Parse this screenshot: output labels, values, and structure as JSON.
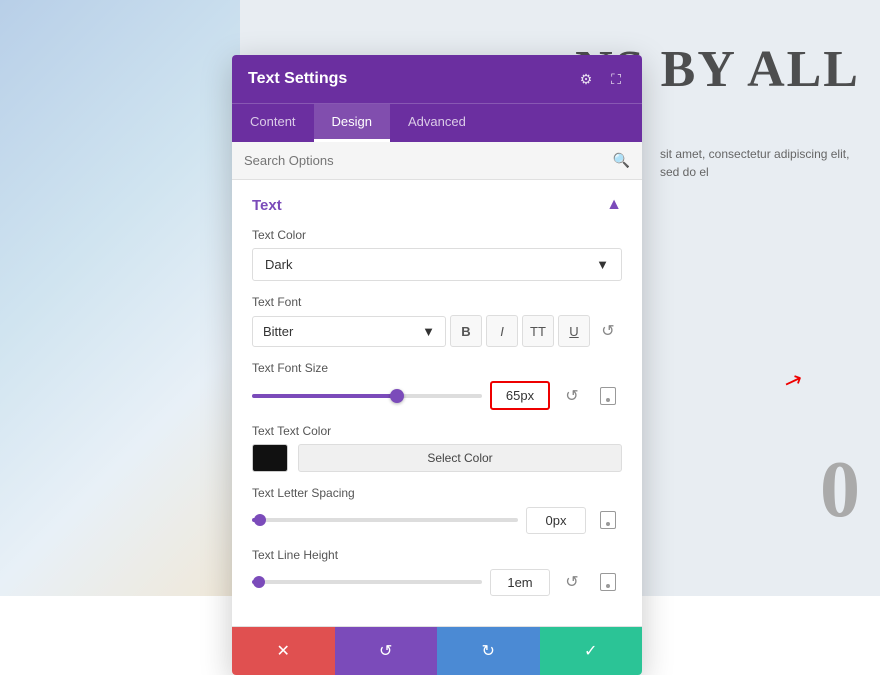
{
  "background": {
    "right_heading": "NS BY ALL",
    "right_body": "sit amet, consectetur adipiscing elit, sed do el",
    "right_zero": "0"
  },
  "panel": {
    "title": "Text Settings",
    "tabs": [
      "Content",
      "Design",
      "Advanced"
    ],
    "active_tab": "Design",
    "search_placeholder": "Search Options",
    "section_title": "Text",
    "text_color_label": "Text Color",
    "text_color_value": "Dark",
    "text_font_label": "Text Font",
    "text_font_value": "Bitter",
    "font_buttons": [
      "B",
      "I",
      "TT",
      "U"
    ],
    "font_size_label": "Text Font Size",
    "font_size_value": "65px",
    "text_text_color_label": "Text Text Color",
    "select_color_label": "Select Color",
    "text_letter_spacing_label": "Text Letter Spacing",
    "letter_spacing_value": "0px",
    "text_line_height_label": "Text Line Height",
    "line_height_value": "1em",
    "footer": {
      "cancel": "✕",
      "reset": "↺",
      "redo": "↻",
      "confirm": "✓"
    }
  }
}
